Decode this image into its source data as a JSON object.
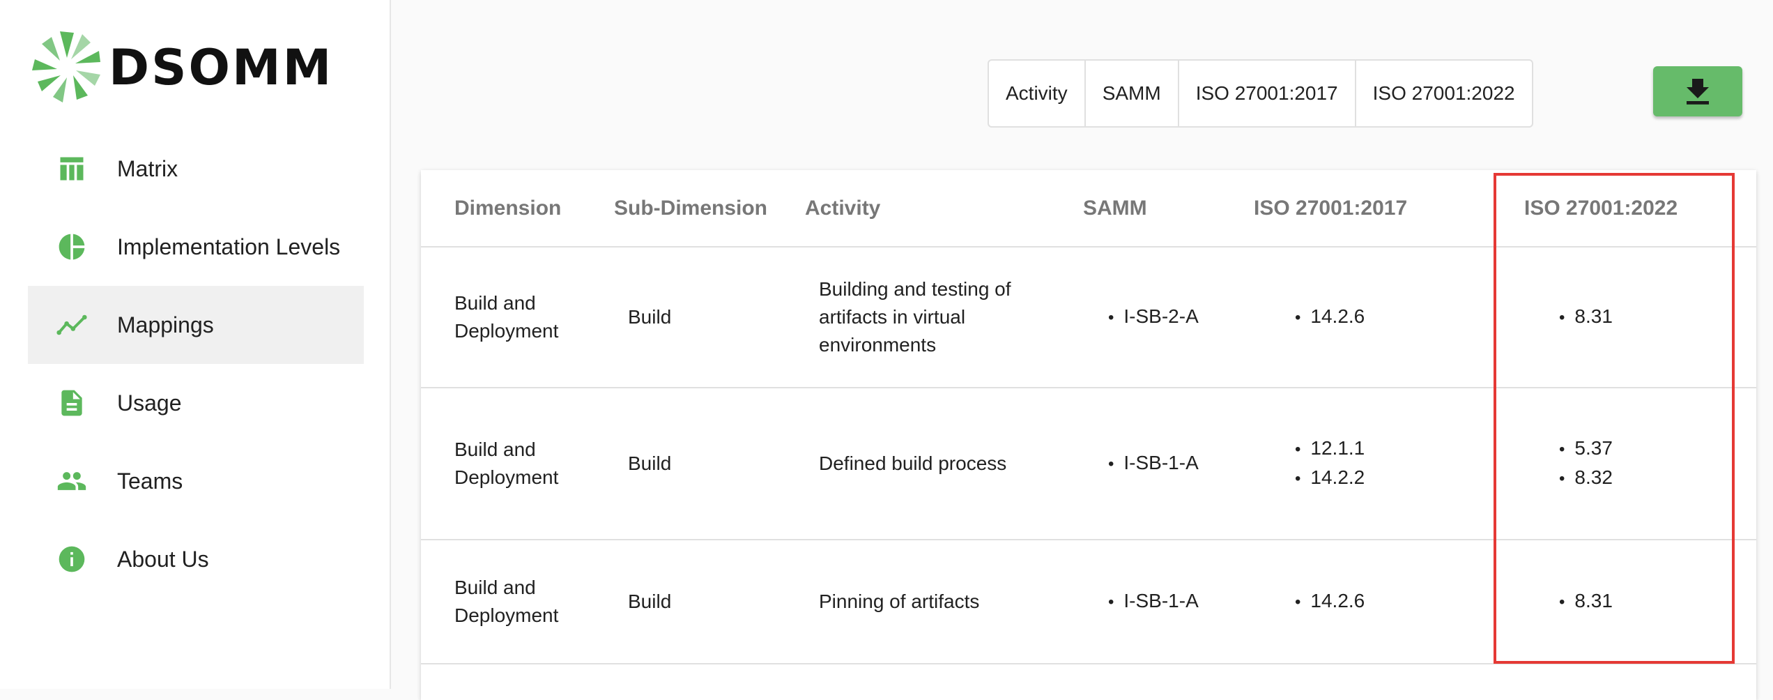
{
  "brand": {
    "name": "DSOMM",
    "logo_color": "#5cb85c"
  },
  "sidebar": {
    "items": [
      {
        "label": "Matrix",
        "icon": "table-icon",
        "active": false
      },
      {
        "label": "Implementation Levels",
        "icon": "pie-chart-icon",
        "active": false
      },
      {
        "label": "Mappings",
        "icon": "trending-up-icon",
        "active": true
      },
      {
        "label": "Usage",
        "icon": "document-icon",
        "active": false
      },
      {
        "label": "Teams",
        "icon": "people-icon",
        "active": false
      },
      {
        "label": "About Us",
        "icon": "info-icon",
        "active": false
      }
    ]
  },
  "toolbar": {
    "toggles": [
      "Activity",
      "SAMM",
      "ISO 27001:2017",
      "ISO 27001:2022"
    ],
    "download_icon": "download-icon",
    "download_color": "#66bb6a"
  },
  "table": {
    "headers": [
      "Dimension",
      "Sub-Dimension",
      "Activity",
      "SAMM",
      "ISO 27001:2017",
      "ISO 27001:2022"
    ],
    "rows": [
      {
        "dimension": "Build and Deployment",
        "subdimension": "Build",
        "activity": "Building and testing of artifacts in virtual environments",
        "samm": [
          "I-SB-2-A"
        ],
        "iso2017": [
          "14.2.6"
        ],
        "iso2022": [
          "8.31"
        ]
      },
      {
        "dimension": "Build and Deployment",
        "subdimension": "Build",
        "activity": "Defined build process",
        "samm": [
          "I-SB-1-A"
        ],
        "iso2017": [
          "12.1.1",
          "14.2.2"
        ],
        "iso2022": [
          "5.37",
          "8.32"
        ]
      },
      {
        "dimension": "Build and Deployment",
        "subdimension": "Build",
        "activity": "Pinning of artifacts",
        "samm": [
          "I-SB-1-A"
        ],
        "iso2017": [
          "14.2.6"
        ],
        "iso2022": [
          "8.31"
        ]
      }
    ]
  },
  "highlight_color": "#e53935"
}
